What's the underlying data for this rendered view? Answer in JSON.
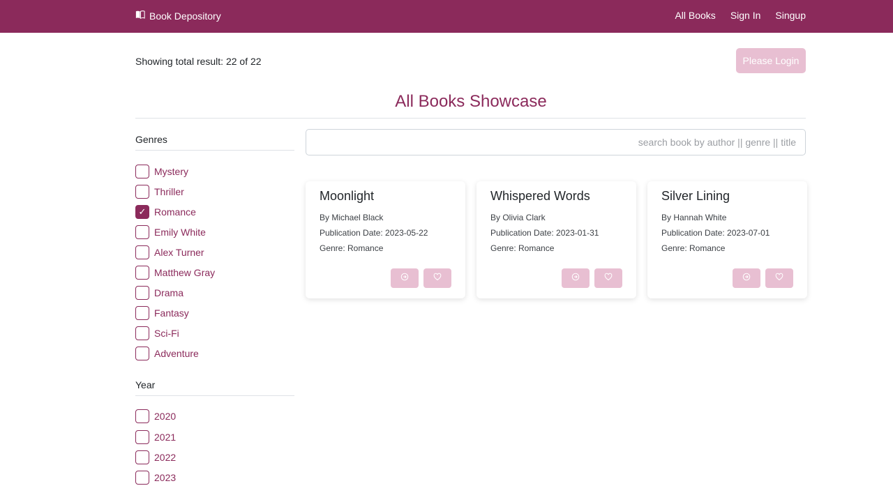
{
  "navbar": {
    "brand": "Book Depository",
    "brand_icon": "book-icon",
    "links": [
      "All Books",
      "Sign In",
      "Singup"
    ],
    "color": "#8b2a5b"
  },
  "header": {
    "result_text": "Showing total result: 22 of 22",
    "login_label": "Please Login",
    "title": "All Books Showcase"
  },
  "filters": {
    "genres": {
      "heading": "Genres",
      "items": [
        {
          "label": "Mystery",
          "checked": false
        },
        {
          "label": "Thriller",
          "checked": false
        },
        {
          "label": "Romance",
          "checked": true
        },
        {
          "label": "Emily White",
          "checked": false
        },
        {
          "label": "Alex Turner",
          "checked": false
        },
        {
          "label": "Matthew Gray",
          "checked": false
        },
        {
          "label": "Drama",
          "checked": false
        },
        {
          "label": "Fantasy",
          "checked": false
        },
        {
          "label": "Sci-Fi",
          "checked": false
        },
        {
          "label": "Adventure",
          "checked": false
        }
      ]
    },
    "years": {
      "heading": "Year",
      "items": [
        {
          "label": "2020",
          "checked": false
        },
        {
          "label": "2021",
          "checked": false
        },
        {
          "label": "2022",
          "checked": false
        },
        {
          "label": "2023",
          "checked": false
        }
      ]
    }
  },
  "search": {
    "placeholder": "search book by author || genre || title",
    "value": ""
  },
  "books": [
    {
      "title": "Moonlight",
      "author": "By Michael Black",
      "date": "Publication Date: 2023-05-22",
      "genre": "Genre: Romance"
    },
    {
      "title": "Whispered Words",
      "author": "By Olivia Clark",
      "date": "Publication Date: 2023-01-31",
      "genre": "Genre: Romance"
    },
    {
      "title": "Silver Lining",
      "author": "By Hannah White",
      "date": "Publication Date: 2023-07-01",
      "genre": "Genre: Romance"
    }
  ],
  "card_icons": [
    "arrow-circle-icon",
    "heart-icon"
  ],
  "colors": {
    "accent": "#8b2a5b",
    "accent_light": "#e8bfd2"
  }
}
